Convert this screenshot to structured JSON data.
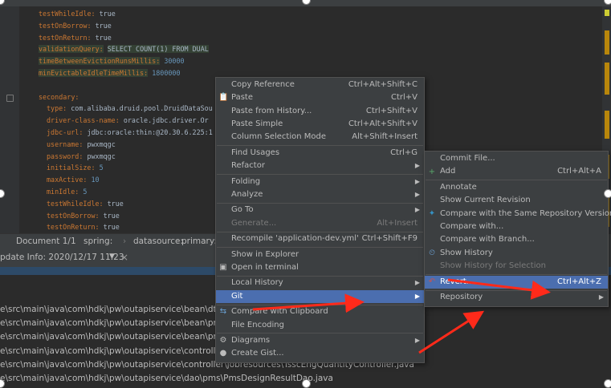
{
  "editor": {
    "lines": [
      {
        "key": "testWhileIdle:",
        "val": "true",
        "indent": 1
      },
      {
        "key": "testOnBorrow:",
        "val": "true",
        "indent": 1
      },
      {
        "key": "testOnReturn:",
        "val": "true",
        "indent": 1
      },
      {
        "key": "validationQuery:",
        "val": "SELECT COUNT(1) FROM DUAL",
        "indent": 1
      },
      {
        "key": "timeBetweenEvictionRunsMillis:",
        "val": "30000",
        "indent": 1
      },
      {
        "key": "minEvictableIdleTimeMillis:",
        "val": "1800000",
        "indent": 1
      },
      {
        "key": "",
        "val": "",
        "indent": 1
      },
      {
        "key": "secondary:",
        "val": "",
        "indent": 1
      },
      {
        "key": "type:",
        "val": "com.alibaba.druid.pool.DruidDataSou",
        "indent": 2
      },
      {
        "key": "driver-class-name:",
        "val": "oracle.jdbc.driver.Or",
        "indent": 2
      },
      {
        "key": "jdbc-url:",
        "val": "jdbc:oracle:thin:@20.30.6.225:1",
        "indent": 2
      },
      {
        "key": "username:",
        "val": "pwxmqgc",
        "indent": 2
      },
      {
        "key": "password:",
        "val": "pwxmqgc",
        "indent": 2
      },
      {
        "key": "initialSize:",
        "val": "5",
        "indent": 2
      },
      {
        "key": "maxActive:",
        "val": "10",
        "indent": 2
      },
      {
        "key": "minIdle:",
        "val": "5",
        "indent": 2
      },
      {
        "key": "testWhileIdle:",
        "val": "true",
        "indent": 2
      },
      {
        "key": "testOnBorrow:",
        "val": "true",
        "indent": 2
      },
      {
        "key": "testOnReturn:",
        "val": "true",
        "indent": 2
      }
    ]
  },
  "breadcrumb": {
    "doc": "Document 1/1",
    "p1": "spring:",
    "p2": "datasource:",
    "p3": "primary:"
  },
  "update_tab": {
    "label": "pdate Info: 2020/12/17 11:23",
    "dropdown": "▼",
    "close": "×"
  },
  "console": {
    "lines": [
      "e\\src\\main\\java\\com\\hdkj\\pw\\outapiservice\\bean\\dto\\Pms",
      "e\\src\\main\\java\\com\\hdkj\\pw\\outapiservice\\bean\\pms\\des",
      "e\\src\\main\\java\\com\\hdkj\\pw\\outapiservice\\bean\\pms\\des",
      "e\\src\\main\\java\\com\\hdkj\\pw\\outapiservice\\controller\\Des",
      "e\\src\\main\\java\\com\\hdkj\\pw\\outapiservice\\controller\\jobresources\\TsscEngQuantityController.java",
      "e\\src\\main\\java\\com\\hdkj\\pw\\outapiservice\\dao\\pms\\PmsDesignResultDao.java"
    ]
  },
  "context_menu": {
    "items": [
      {
        "label": "Copy Reference",
        "shortcut": "Ctrl+Alt+Shift+C",
        "icon": "",
        "submenu": false,
        "disabled": false
      },
      {
        "label": "Paste",
        "shortcut": "Ctrl+V",
        "icon": "paste-icon",
        "submenu": false,
        "disabled": false
      },
      {
        "label": "Paste from History...",
        "shortcut": "Ctrl+Shift+V",
        "icon": "",
        "submenu": false,
        "disabled": false
      },
      {
        "label": "Paste Simple",
        "shortcut": "Ctrl+Alt+Shift+V",
        "icon": "",
        "submenu": false,
        "disabled": false
      },
      {
        "label": "Column Selection Mode",
        "shortcut": "Alt+Shift+Insert",
        "icon": "",
        "submenu": false,
        "disabled": false
      },
      {
        "sep": true
      },
      {
        "label": "Find Usages",
        "shortcut": "Ctrl+G",
        "icon": "",
        "submenu": false,
        "disabled": false
      },
      {
        "label": "Refactor",
        "shortcut": "",
        "icon": "",
        "submenu": true,
        "disabled": false
      },
      {
        "sep": true
      },
      {
        "label": "Folding",
        "shortcut": "",
        "icon": "",
        "submenu": true,
        "disabled": false
      },
      {
        "label": "Analyze",
        "shortcut": "",
        "icon": "",
        "submenu": true,
        "disabled": false
      },
      {
        "sep": true
      },
      {
        "label": "Go To",
        "shortcut": "",
        "icon": "",
        "submenu": true,
        "disabled": false
      },
      {
        "label": "Generate...",
        "shortcut": "Alt+Insert",
        "icon": "",
        "submenu": false,
        "disabled": true
      },
      {
        "sep": true
      },
      {
        "label": "Recompile 'application-dev.yml'",
        "shortcut": "Ctrl+Shift+F9",
        "icon": "",
        "submenu": false,
        "disabled": false
      },
      {
        "sep": true
      },
      {
        "label": "Show in Explorer",
        "shortcut": "",
        "icon": "",
        "submenu": false,
        "disabled": false
      },
      {
        "label": "Open in terminal",
        "shortcut": "",
        "icon": "terminal-icon",
        "submenu": false,
        "disabled": false
      },
      {
        "sep": true
      },
      {
        "label": "Local History",
        "shortcut": "",
        "icon": "",
        "submenu": true,
        "disabled": false
      },
      {
        "label": "Git",
        "shortcut": "",
        "icon": "",
        "submenu": true,
        "disabled": false,
        "highlight": true
      },
      {
        "sep": true
      },
      {
        "label": "Compare with Clipboard",
        "shortcut": "",
        "icon": "compare-icon",
        "submenu": false,
        "disabled": false
      },
      {
        "label": "File Encoding",
        "shortcut": "",
        "icon": "",
        "submenu": false,
        "disabled": false
      },
      {
        "sep": true
      },
      {
        "label": "Diagrams",
        "shortcut": "",
        "icon": "diagram-icon",
        "submenu": true,
        "disabled": false
      },
      {
        "label": "Create Gist...",
        "shortcut": "",
        "icon": "github-icon",
        "submenu": false,
        "disabled": false
      }
    ]
  },
  "git_menu": {
    "items": [
      {
        "label": "Commit File...",
        "shortcut": "",
        "icon": "",
        "submenu": false,
        "disabled": false
      },
      {
        "label": "Add",
        "shortcut": "Ctrl+Alt+A",
        "icon": "plus-icon",
        "submenu": false,
        "disabled": false
      },
      {
        "sep": true
      },
      {
        "label": "Annotate",
        "shortcut": "",
        "icon": "",
        "submenu": false,
        "disabled": false
      },
      {
        "label": "Show Current Revision",
        "shortcut": "",
        "icon": "",
        "submenu": false,
        "disabled": false
      },
      {
        "label": "Compare with the Same Repository Version",
        "shortcut": "",
        "icon": "compare-repo-icon",
        "submenu": false,
        "disabled": false
      },
      {
        "label": "Compare with...",
        "shortcut": "",
        "icon": "",
        "submenu": false,
        "disabled": false
      },
      {
        "label": "Compare with Branch...",
        "shortcut": "",
        "icon": "",
        "submenu": false,
        "disabled": false
      },
      {
        "label": "Show History",
        "shortcut": "",
        "icon": "history-icon",
        "submenu": false,
        "disabled": false
      },
      {
        "label": "Show History for Selection",
        "shortcut": "",
        "icon": "",
        "submenu": false,
        "disabled": true
      },
      {
        "sep": true
      },
      {
        "label": "Revert...",
        "shortcut": "Ctrl+Alt+Z",
        "icon": "revert-icon",
        "submenu": false,
        "disabled": false,
        "highlight": true
      },
      {
        "sep": true
      },
      {
        "label": "Repository",
        "shortcut": "",
        "icon": "",
        "submenu": true,
        "disabled": false
      }
    ]
  },
  "colors": {
    "menu_bg": "#3c3f41",
    "highlight": "#4b6eaf",
    "annotation_arrow": "#ff2a1a",
    "yaml_key": "#cc7832"
  }
}
